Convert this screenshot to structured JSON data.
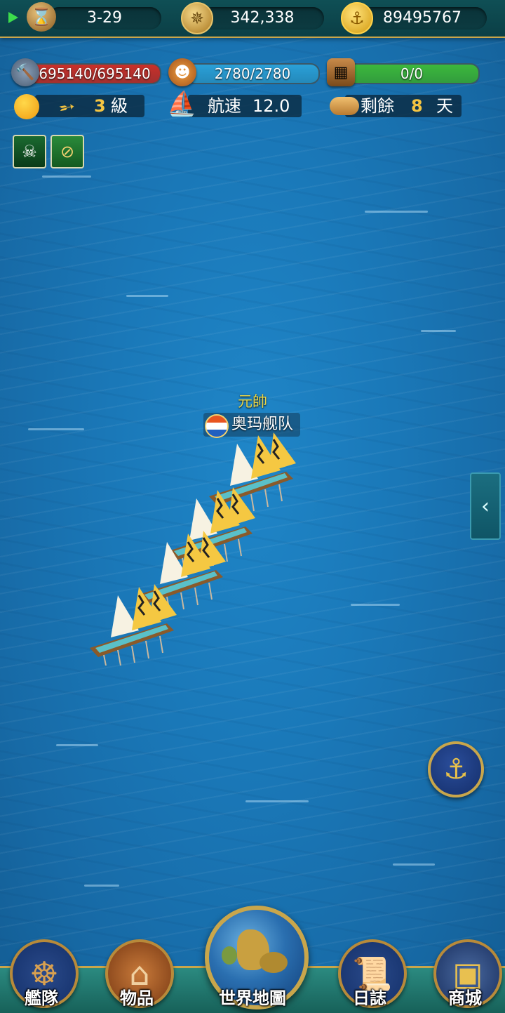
{
  "topbar": {
    "date": "3-29",
    "date_icon": "hourglass-icon",
    "reputation": "342,338",
    "reputation_icon": "compass-icon",
    "gold": "89495767",
    "gold_icon": "gold-coin-icon"
  },
  "stats": {
    "durability": {
      "value": "695140/695140",
      "fill": 1.0,
      "color": "#c8302a",
      "icon": "hammer-icon"
    },
    "crew": {
      "value": "2780/2780",
      "fill": 1.0,
      "color": "#2aa0d8",
      "icon": "crew-icon"
    },
    "cargo": {
      "value": "0/0",
      "fill": 1.0,
      "color": "#3cb83c",
      "icon": "cargo-box-icon"
    }
  },
  "info": {
    "weather_icon": "sun-icon",
    "wind_icon": "wind-icon",
    "wind_level_num": "3",
    "wind_level_unit": "級",
    "speed_label": "航速",
    "speed_value": "12.0",
    "food_label": "剩餘",
    "food_days": "8",
    "food_unit": "天"
  },
  "buffs": [
    "pirate-flag-icon",
    "compass-speed-icon"
  ],
  "fleet": {
    "rank": "元帥",
    "name": "奥玛舰队"
  },
  "nav": [
    {
      "label": "艦隊",
      "icon": "ship-wheel-icon"
    },
    {
      "label": "物品",
      "icon": "satchel-icon"
    },
    {
      "label": "世界地圖",
      "icon": "globe-icon"
    },
    {
      "label": "日誌",
      "icon": "scroll-icon"
    },
    {
      "label": "商城",
      "icon": "treasure-chest-icon"
    }
  ],
  "side_tab_icon": "chevron-left-icon",
  "anchor_icon": "anchor-icon"
}
